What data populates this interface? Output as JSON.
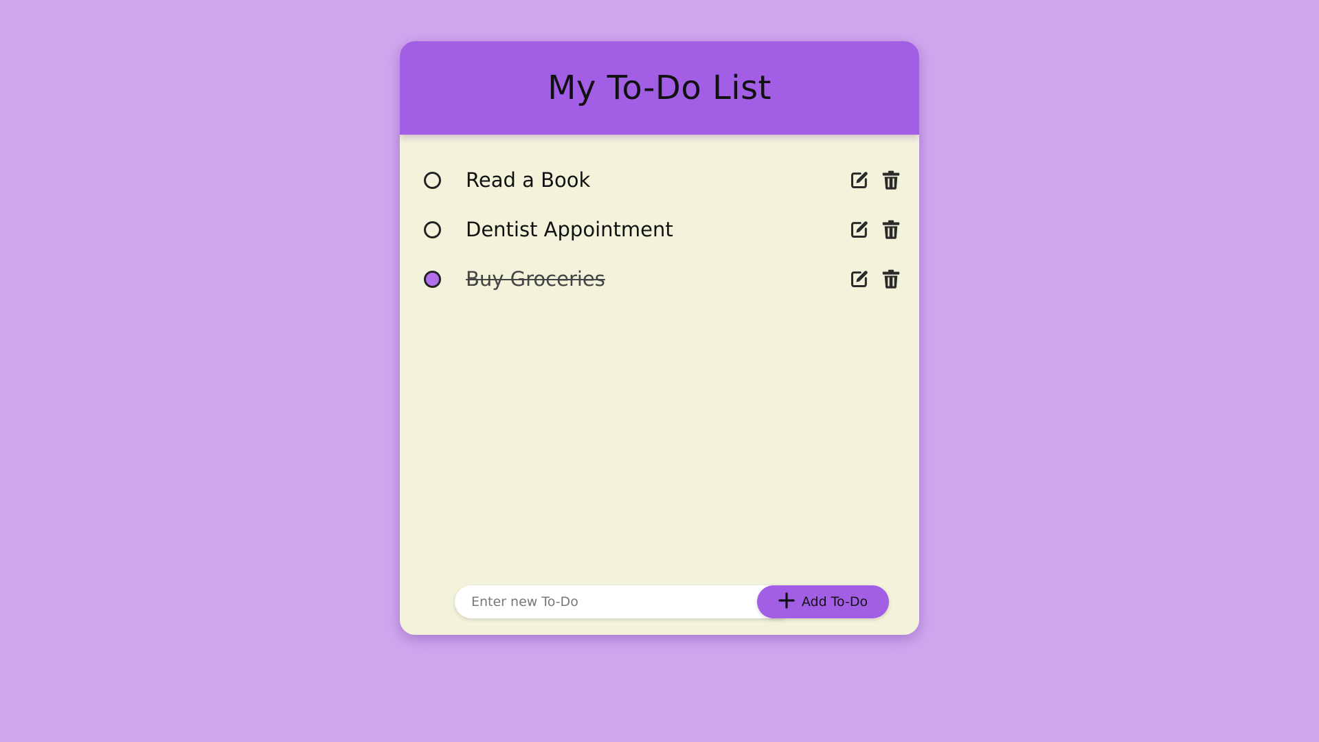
{
  "colors": {
    "background": "#d0a8ee",
    "accent": "#a35ee6",
    "card": "#f3f3dc",
    "checked": "#b170ea"
  },
  "header": {
    "title": "My To-Do List"
  },
  "todos": [
    {
      "label": "Read a Book",
      "completed": false
    },
    {
      "label": "Dentist Appointment",
      "completed": false
    },
    {
      "label": "Buy Groceries",
      "completed": true
    }
  ],
  "icons": {
    "edit": "edit-icon",
    "delete": "trash-icon",
    "add": "plus-icon"
  },
  "add_form": {
    "placeholder": "Enter new To-Do",
    "value": "",
    "button_label": "Add To-Do"
  }
}
